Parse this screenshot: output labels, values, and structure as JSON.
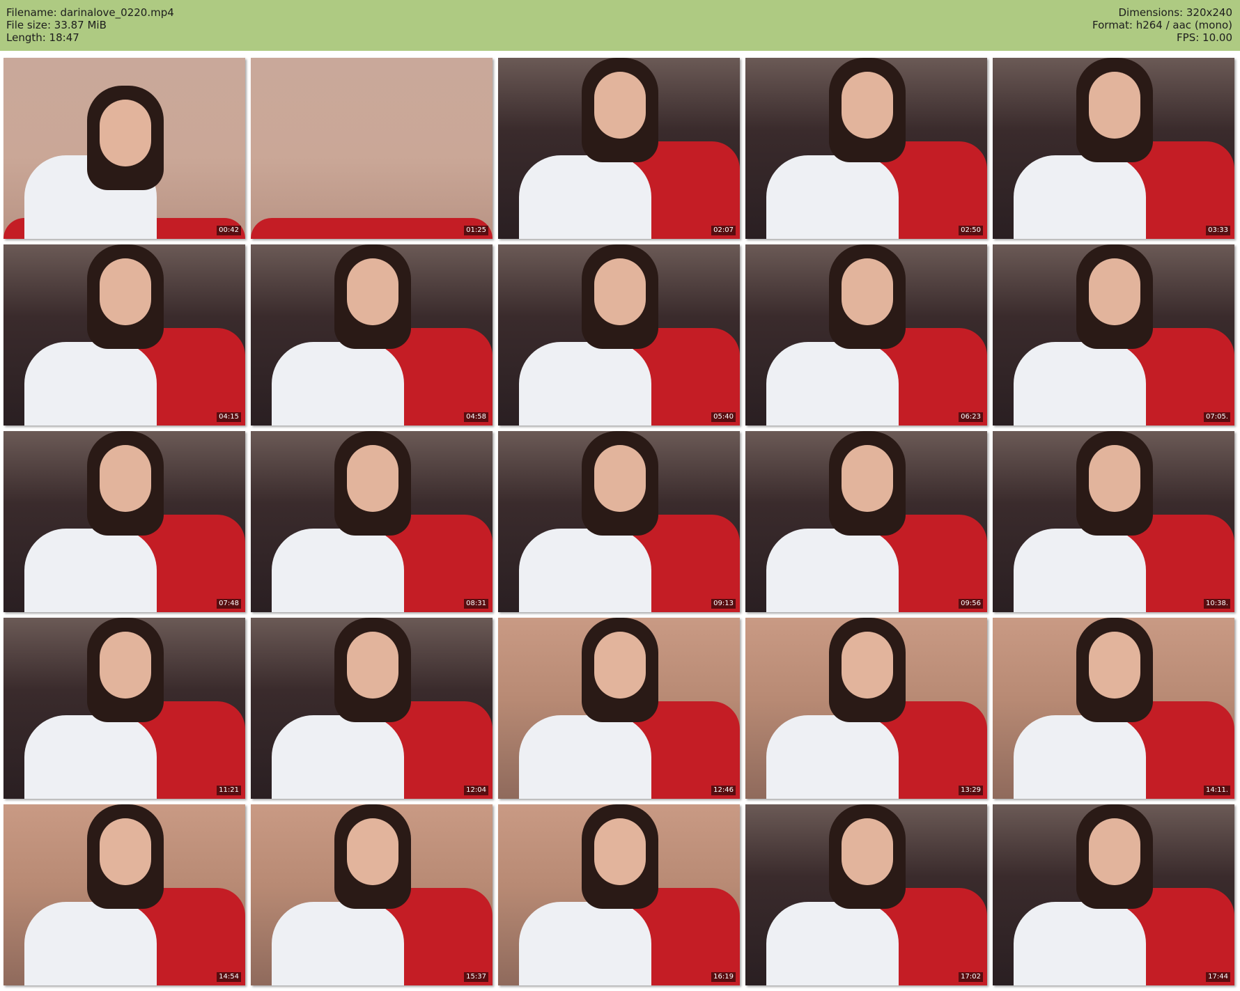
{
  "header": {
    "filename": "Filename: darinalove_0220.mp4",
    "filesize": "File size: 33.87 MiB",
    "length": "Length: 18:47",
    "dimensions": "Dimensions: 320x240",
    "format": "Format: h264 / aac (mono)",
    "fps": "FPS: 10.00"
  },
  "colors": {
    "header_bg": "#aeca82",
    "page_bg": "#ffffff"
  },
  "thumbnails": [
    {
      "time": "00:42",
      "scene": "wall"
    },
    {
      "time": "01:25",
      "scene": "wall"
    },
    {
      "time": "02:07",
      "scene": "bed"
    },
    {
      "time": "02:50",
      "scene": "bed"
    },
    {
      "time": "03:33",
      "scene": "bed"
    },
    {
      "time": "04:15",
      "scene": "bed"
    },
    {
      "time": "04:58",
      "scene": "bed"
    },
    {
      "time": "05:40",
      "scene": "bed"
    },
    {
      "time": "06:23",
      "scene": "bed"
    },
    {
      "time": "07:05.",
      "scene": "bed"
    },
    {
      "time": "07:48",
      "scene": "bed"
    },
    {
      "time": "08:31",
      "scene": "bed"
    },
    {
      "time": "09:13",
      "scene": "bed"
    },
    {
      "time": "09:56",
      "scene": "bed"
    },
    {
      "time": "10:38.",
      "scene": "bed"
    },
    {
      "time": "11:21",
      "scene": "bed"
    },
    {
      "time": "12:04",
      "scene": "bed"
    },
    {
      "time": "12:46",
      "scene": "room"
    },
    {
      "time": "13:29",
      "scene": "room"
    },
    {
      "time": "14:11.",
      "scene": "room"
    },
    {
      "time": "14:54",
      "scene": "room"
    },
    {
      "time": "15:37",
      "scene": "room"
    },
    {
      "time": "16:19",
      "scene": "room"
    },
    {
      "time": "17:02",
      "scene": "bed"
    },
    {
      "time": "17:44",
      "scene": "bed"
    }
  ]
}
